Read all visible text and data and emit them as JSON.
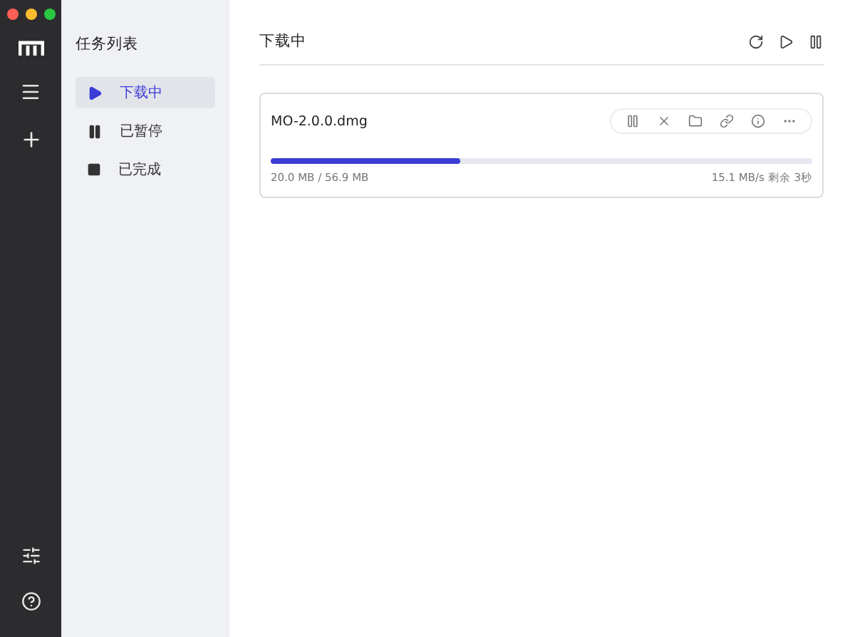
{
  "sidebar": {
    "title": "任务列表",
    "items": [
      {
        "label": "下载中",
        "kind": "play",
        "selected": true
      },
      {
        "label": "已暂停",
        "kind": "pause",
        "selected": false
      },
      {
        "label": "已完成",
        "kind": "stop",
        "selected": false
      }
    ]
  },
  "main": {
    "title": "下载中"
  },
  "tasks": [
    {
      "name": "MO-2.0.0.dmg",
      "level": 0.35,
      "size": "20.0 MB / 56.9 MB",
      "speed": "15.1 MB/s 剩余 3秒"
    }
  ]
}
